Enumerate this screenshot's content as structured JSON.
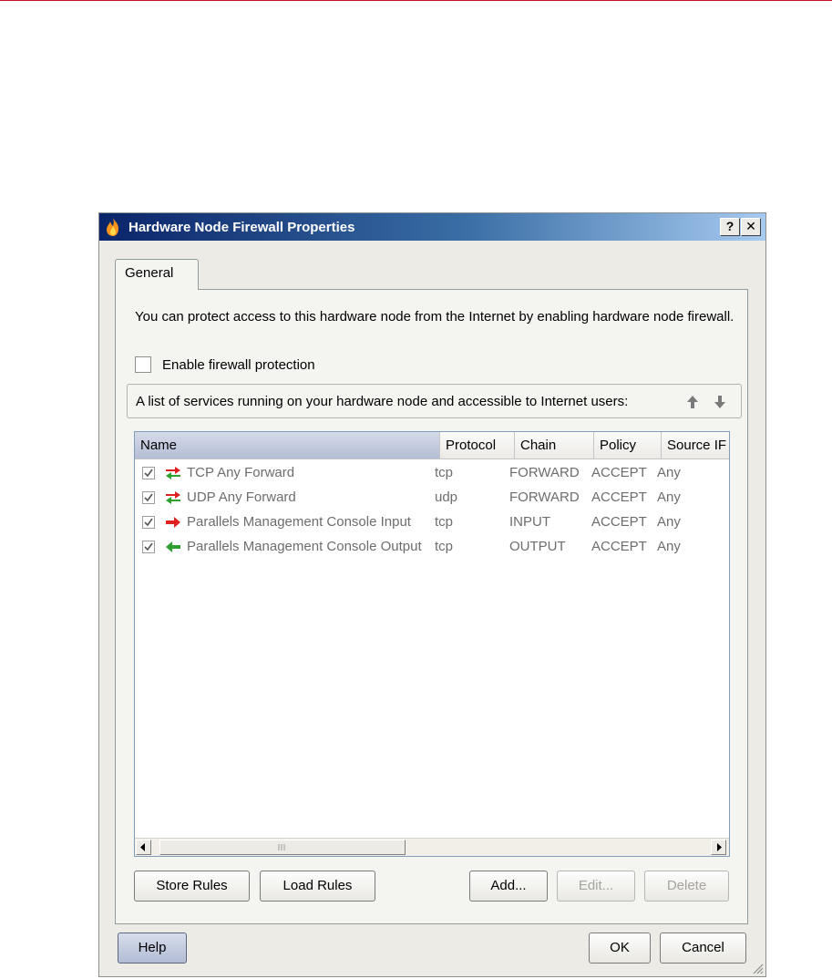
{
  "window": {
    "title": "Hardware Node Firewall Properties",
    "help_glyph": "?",
    "close_glyph": "✕"
  },
  "tabs": [
    {
      "label": "General",
      "active": true
    }
  ],
  "general": {
    "description": "You can protect access to this hardware node from the Internet by enabling hardware node firewall.",
    "enable_label": "Enable firewall protection",
    "enable_checked": false,
    "services_caption": "A list of services running on your hardware node and accessible to Internet users:"
  },
  "rules_table": {
    "columns": [
      "Name",
      "Protocol",
      "Chain",
      "Policy",
      "Source IF"
    ],
    "sorted_column": "Name",
    "rows": [
      {
        "checked": true,
        "icon": "bidirectional-arrows-icon",
        "name": "TCP Any Forward",
        "protocol": "tcp",
        "chain": "FORWARD",
        "policy": "ACCEPT",
        "source": "Any"
      },
      {
        "checked": true,
        "icon": "bidirectional-arrows-icon",
        "name": "UDP Any Forward",
        "protocol": "udp",
        "chain": "FORWARD",
        "policy": "ACCEPT",
        "source": "Any"
      },
      {
        "checked": true,
        "icon": "arrow-right-red-icon",
        "name": "Parallels Management Console Input",
        "protocol": "tcp",
        "chain": "INPUT",
        "policy": "ACCEPT",
        "source": "Any"
      },
      {
        "checked": true,
        "icon": "arrow-left-green-icon",
        "name": "Parallels Management Console Output",
        "protocol": "tcp",
        "chain": "OUTPUT",
        "policy": "ACCEPT",
        "source": "Any"
      }
    ]
  },
  "buttons": {
    "store_rules": "Store Rules",
    "load_rules": "Load Rules",
    "add": "Add...",
    "edit": "Edit...",
    "delete": "Delete",
    "help": "Help",
    "ok": "OK",
    "cancel": "Cancel"
  },
  "colors": {
    "titlebar_start": "#0a246a",
    "titlebar_end": "#a6caf0",
    "arrow_red": "#e02020",
    "arrow_green": "#2da02d",
    "row_text": "#6d6d6d"
  }
}
